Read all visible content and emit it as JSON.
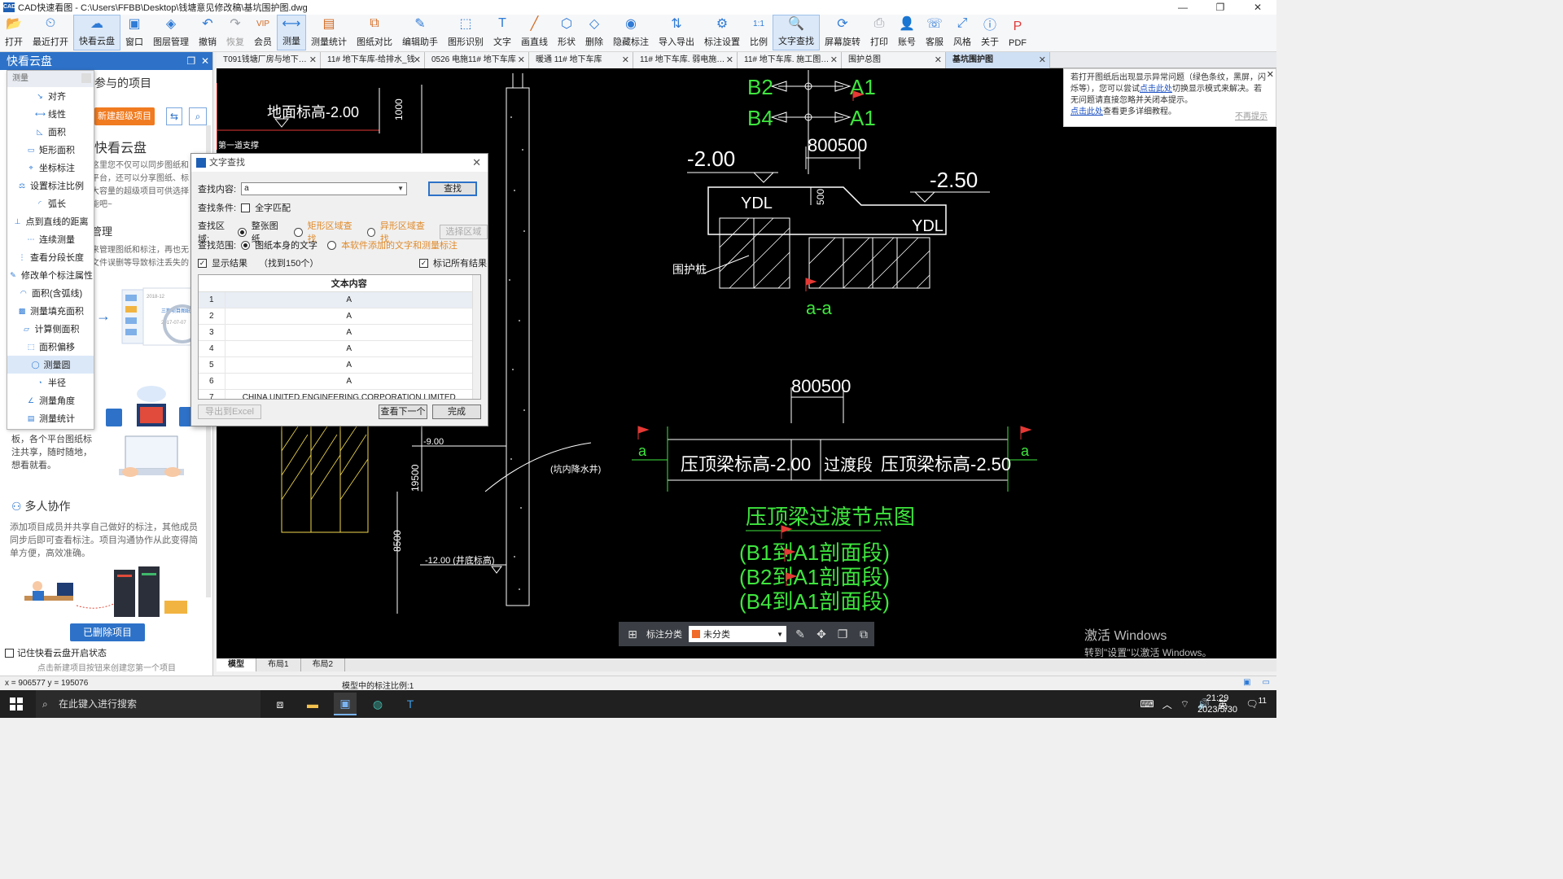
{
  "window": {
    "title": "CAD快速看图 - C:\\Users\\FFBB\\Desktop\\钱塘意见修改稿\\基坑围护图.dwg",
    "controls": [
      "—",
      "❐",
      "✕"
    ]
  },
  "toolbar": [
    {
      "label": "打开",
      "icon": "folder-icon",
      "glyph": "📂"
    },
    {
      "label": "最近打开",
      "icon": "clock-icon",
      "glyph": "⏲"
    },
    {
      "label": "快看云盘",
      "icon": "cloud-icon",
      "glyph": "☁",
      "active": true
    },
    {
      "label": "窗口",
      "icon": "window-icon",
      "glyph": "▣"
    },
    {
      "label": "图层管理",
      "icon": "layers-icon",
      "glyph": "◈"
    },
    {
      "label": "撤销",
      "icon": "undo-icon",
      "glyph": "↶"
    },
    {
      "label": "恢复",
      "icon": "redo-icon",
      "glyph": "↷",
      "disabled": true
    },
    {
      "label": "会员",
      "icon": "vip-icon",
      "glyph": "VIP",
      "orange": true
    },
    {
      "label": "测量",
      "icon": "measure-icon",
      "glyph": "⟷",
      "active": true
    },
    {
      "label": "测量统计",
      "icon": "measure-stats-icon",
      "glyph": "▤",
      "orange": true
    },
    {
      "label": "图纸对比",
      "icon": "compare-icon",
      "glyph": "⧉",
      "orange": true
    },
    {
      "label": "编辑助手",
      "icon": "edit-assistant-icon",
      "glyph": "✎"
    },
    {
      "label": "图形识别",
      "icon": "shape-recognition-icon",
      "glyph": "⬚"
    },
    {
      "label": "文字",
      "icon": "text-icon",
      "glyph": "T"
    },
    {
      "label": "画直线",
      "icon": "line-icon",
      "glyph": "╱",
      "orange": true
    },
    {
      "label": "形状",
      "icon": "shape-icon",
      "glyph": "⬡"
    },
    {
      "label": "删除",
      "icon": "eraser-icon",
      "glyph": "◇"
    },
    {
      "label": "隐藏标注",
      "icon": "hide-annotation-icon",
      "glyph": "◉"
    },
    {
      "label": "导入导出",
      "icon": "import-export-icon",
      "glyph": "⇅"
    },
    {
      "label": "标注设置",
      "icon": "annotation-settings-icon",
      "glyph": "⚙"
    },
    {
      "label": "比例",
      "icon": "scale-icon",
      "glyph": "1:1"
    },
    {
      "label": "文字查找",
      "icon": "text-search-icon",
      "glyph": "🔍",
      "active": true
    },
    {
      "label": "屏幕旋转",
      "icon": "rotate-screen-icon",
      "glyph": "⟳"
    },
    {
      "label": "打印",
      "icon": "print-icon",
      "glyph": "⎙",
      "gray": true
    },
    {
      "label": "账号",
      "icon": "account-icon",
      "glyph": "👤"
    },
    {
      "label": "客服",
      "icon": "headset-icon",
      "glyph": "☏"
    },
    {
      "label": "风格",
      "icon": "style-icon",
      "glyph": "⤢"
    },
    {
      "label": "关于",
      "icon": "info-icon",
      "glyph": "ⓘ"
    },
    {
      "label": "PDF",
      "icon": "pdf-icon",
      "glyph": "P",
      "red": true
    }
  ],
  "left_panel": {
    "title": "快看云盘",
    "subtitle": "参与的项目",
    "new_project": "新建超级项目",
    "heading": "快看云盘",
    "para1": "这里您不仅可以同步图纸和\n平台，还可以分享图纸、标\n大容量的超级项目可供选择\n能吧~",
    "manage_title": "管理",
    "para2": "来管理图纸和标注，再也无\n文件误删等导致标注丢失的",
    "side_text": "板，各个平台图纸标\n注共享，随时随地，\n想看就看。",
    "collab_title": "多人协作",
    "collab_text": "添加项目成员并共享自己做好的标注，其他成员同步后即可查看标注。项目沟通协作从此变得简单方便，高效准确。",
    "deleted_btn": "已删除项目",
    "remember": "记住快看云盘开启状态",
    "hint": "点击新建项目按钮来创建您第一个项目",
    "illustration_text": [
      "2018-12",
      "三期项目图纸",
      "2017-07-07"
    ]
  },
  "measure_menu": {
    "header": "测量",
    "items": [
      {
        "label": "对齐",
        "name": "align",
        "glyph": "↘"
      },
      {
        "label": "线性",
        "name": "linear",
        "glyph": "⟷"
      },
      {
        "label": "面积",
        "name": "area",
        "glyph": "◺"
      },
      {
        "label": "矩形面积",
        "name": "rect-area",
        "glyph": "▭"
      },
      {
        "label": "坐标标注",
        "name": "coordinate",
        "glyph": "⌖"
      },
      {
        "label": "设置标注比例",
        "name": "set-scale",
        "glyph": "⚖"
      },
      {
        "label": "弧长",
        "name": "arc-length",
        "glyph": "◜"
      },
      {
        "label": "点到直线的距离",
        "name": "point-line-distance",
        "glyph": "⊥"
      },
      {
        "label": "连续测量",
        "name": "continuous",
        "glyph": "⋯"
      },
      {
        "label": "查看分段长度",
        "name": "segment-length",
        "glyph": "⋮"
      },
      {
        "label": "修改单个标注属性",
        "name": "edit-annotation",
        "glyph": "✎"
      },
      {
        "label": "面积(含弧线)",
        "name": "area-arc",
        "glyph": "◠"
      },
      {
        "label": "测量填充面积",
        "name": "fill-area",
        "glyph": "▩"
      },
      {
        "label": "计算侧面积",
        "name": "side-area",
        "glyph": "▱"
      },
      {
        "label": "面积偏移",
        "name": "area-offset",
        "glyph": "⬚"
      },
      {
        "label": "测量圆",
        "name": "circle",
        "glyph": "◯",
        "highlight": true
      },
      {
        "label": "半径",
        "name": "radius",
        "glyph": "◔"
      },
      {
        "label": "测量角度",
        "name": "angle",
        "glyph": "∠"
      },
      {
        "label": "测量统计",
        "name": "stats",
        "glyph": "▤"
      }
    ]
  },
  "tabs": [
    {
      "label": "T091钱塘厂房与地下…",
      "active": false
    },
    {
      "label": "11# 地下车库-给排水_钱",
      "active": false
    },
    {
      "label": "0526 电施11# 地下车库",
      "active": false
    },
    {
      "label": "暖通 11# 地下车库",
      "active": false
    },
    {
      "label": "11# 地下车库. 弱电施…",
      "active": false
    },
    {
      "label": "11# 地下车库. 施工图…",
      "active": false
    },
    {
      "label": "围护总图",
      "active": false
    },
    {
      "label": "基坑围护图",
      "active": true
    }
  ],
  "notice": {
    "text1": "若打开图纸后出现显示异常问题（绿色条纹，黑屏，闪烁等），您可以尝试",
    "link1": "点击此处",
    "text2": "切换显示模式来解决。若无问题请直接忽略并关闭本提示。",
    "link2": "点击此处",
    "text3": "查看更多详细教程。",
    "dismiss": "不再提示"
  },
  "find_dialog": {
    "title": "文字查找",
    "content_label": "查找内容:",
    "content_value": "a",
    "find_btn": "查找",
    "condition_label": "查找条件:",
    "exact_match": "全字匹配",
    "area_label": "查找区域:",
    "area_options": [
      "整张图纸",
      "矩形区域查找",
      "异形区域查找"
    ],
    "select_area_btn": "选择区域",
    "range_label": "查找范围:",
    "range_options": [
      "图纸本身的文字",
      "本软件添加的文字和测量标注"
    ],
    "show_results": "显示结果",
    "found_text": "（找到150个）",
    "mark_all": "标记所有结果",
    "table_header": "文本内容",
    "rows": [
      {
        "n": "1",
        "text": "A"
      },
      {
        "n": "2",
        "text": "A"
      },
      {
        "n": "3",
        "text": "A"
      },
      {
        "n": "4",
        "text": "A"
      },
      {
        "n": "5",
        "text": "A"
      },
      {
        "n": "6",
        "text": "A"
      },
      {
        "n": "7",
        "text": "CHINA UNITED ENGINEERING CORPORATION LIMITED"
      }
    ],
    "export_btn": "导出到Excel",
    "next_btn": "查看下一个",
    "done_btn": "完成"
  },
  "drawing_text": {
    "b2": "B2",
    "b4": "B4",
    "a1": "A1",
    "a1b": "A1",
    "dim_top": "800500",
    "elev_left": "-2.00",
    "elev_right": "-2.50",
    "ydl1": "YDL",
    "ydl2": "YDL",
    "dim_500": "500",
    "weiguzhuang": "围护桩",
    "section": "a-a",
    "dim_mid": "800500",
    "beam_left": "压顶梁标高-2.00",
    "transition": "过渡段",
    "beam_right": "压顶梁标高-2.50",
    "sec_a_left": "a",
    "sec_a_right": "a",
    "detail_title": "压顶梁过渡节点图",
    "detail_1": "(B1到A1剖面段)",
    "detail_2": "(B2到A1剖面段)",
    "detail_3": "(B4到A1剖面段)",
    "left_elev": "地面标高-2.00",
    "dim_1000": "1000",
    "support": "第一道支撑",
    "elev_900": "-9.00",
    "elev_1200": "-12.00 (井底标高)",
    "dim_19500": "19500",
    "dim_8500": "8500",
    "well": "(坑内降水井)"
  },
  "float_bar": {
    "label": "标注分类",
    "selected": "未分类",
    "swatch_color": "#f06a2a"
  },
  "watermark": {
    "line1": "激活 Windows",
    "line2": "转到\"设置\"以激活 Windows。"
  },
  "layout_tabs": [
    "模型",
    "布局1",
    "布局2"
  ],
  "status": {
    "coords": "x = 906577  y = 195076",
    "scale": "模型中的标注比例:1"
  },
  "taskbar": {
    "search": "在此键入进行搜索",
    "time": "21:29",
    "date": "2023/5/30",
    "ime": "英",
    "notifications": "11"
  }
}
